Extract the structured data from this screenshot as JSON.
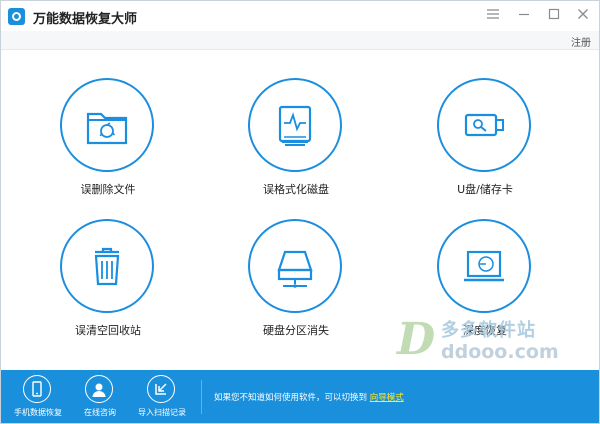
{
  "window": {
    "title": "万能数据恢复大师"
  },
  "window_controls": {
    "menu_icon": "menu-icon",
    "minimize": "minimize-icon",
    "maximize": "maximize-icon",
    "close": "close-icon"
  },
  "header": {
    "register_label": "注册"
  },
  "tiles": [
    {
      "label": "误删除文件",
      "icon": "folder-recycle-icon"
    },
    {
      "label": "误格式化磁盘",
      "icon": "disk-pulse-icon"
    },
    {
      "label": "U盘/储存卡",
      "icon": "usb-drive-icon"
    },
    {
      "label": "误清空回收站",
      "icon": "trash-bin-icon"
    },
    {
      "label": "硬盘分区消失",
      "icon": "hard-drive-network-icon"
    },
    {
      "label": "深度恢复",
      "icon": "laptop-scan-icon"
    }
  ],
  "bottom_bar": {
    "buttons": [
      {
        "label": "手机数据恢复",
        "icon": "phone-icon"
      },
      {
        "label": "在线咨询",
        "icon": "user-support-icon"
      },
      {
        "label": "导入扫描记录",
        "icon": "import-icon"
      }
    ],
    "hint_text": "如果您不知道如何使用软件，可以切换到",
    "hint_link": "向导模式"
  },
  "watermark": {
    "logo_letter": "D",
    "text": "多多软件站",
    "url": "ddooo.com"
  },
  "colors": {
    "accent": "#1a8fdc",
    "circle_border": "#1b8ee0",
    "link": "#ffea2e"
  }
}
